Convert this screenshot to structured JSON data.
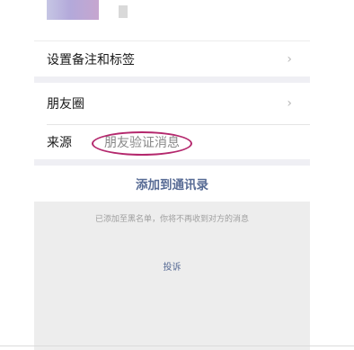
{
  "rows": {
    "tags_label": "设置备注和标签",
    "moments_label": "朋友圈",
    "source_label": "来源",
    "source_value": "朋友验证消息",
    "chevron": "›"
  },
  "actions": {
    "add_to_contacts": "添加到通讯录",
    "blacklist_notice": "已添加至黑名单，你将不再收到对方的消息",
    "report": "投诉"
  },
  "colors": {
    "link_blue": "#576b95",
    "highlight_ring": "#b4286d",
    "section_gap": "#efeff4"
  }
}
